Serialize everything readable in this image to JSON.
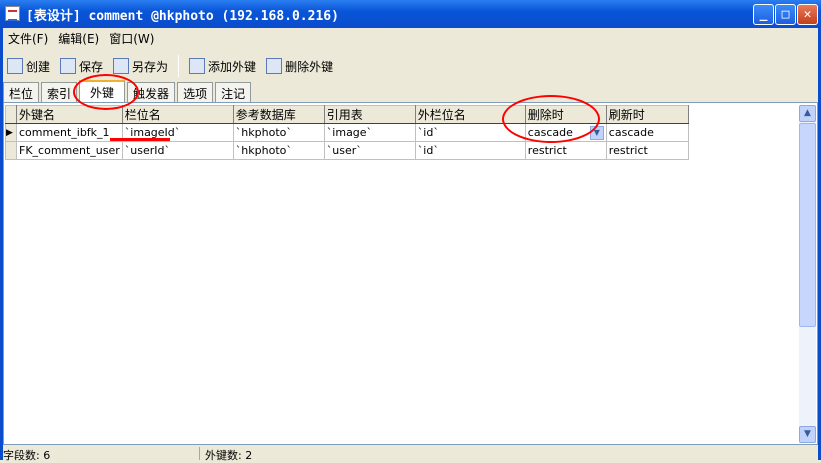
{
  "window": {
    "title": "[表设计] comment @hkphoto (192.168.0.216)",
    "min": "_",
    "max": "□",
    "close": "✕"
  },
  "menu": [
    "文件(F)",
    "编辑(E)",
    "窗口(W)"
  ],
  "toolbar": {
    "create": "创建",
    "save": "保存",
    "save_as": "另存为",
    "add_fk": "添加外键",
    "delete_fk": "删除外键"
  },
  "tabs": [
    "栏位",
    "索引",
    "外键",
    "触发器",
    "选项",
    "注记"
  ],
  "active_tab": "外键",
  "grid": {
    "columns": [
      "外键名",
      "栏位名",
      "参考数据库",
      "引用表",
      "外栏位名",
      "删除时",
      "刷新时"
    ],
    "rows": [
      [
        "comment_ibfk_1",
        "`imageId`",
        "`hkphoto`",
        "`image`",
        "`id`",
        "cascade",
        "cascade"
      ],
      [
        "FK_comment_user",
        "`userId`",
        "`hkphoto`",
        "`user`",
        "`id`",
        "restrict",
        "restrict"
      ]
    ]
  },
  "status": {
    "fields": "字段数: 6",
    "fks": "外键数: 2"
  },
  "colors": {
    "annotation": "#ff0000",
    "titlebar": "#0a4ccc"
  }
}
